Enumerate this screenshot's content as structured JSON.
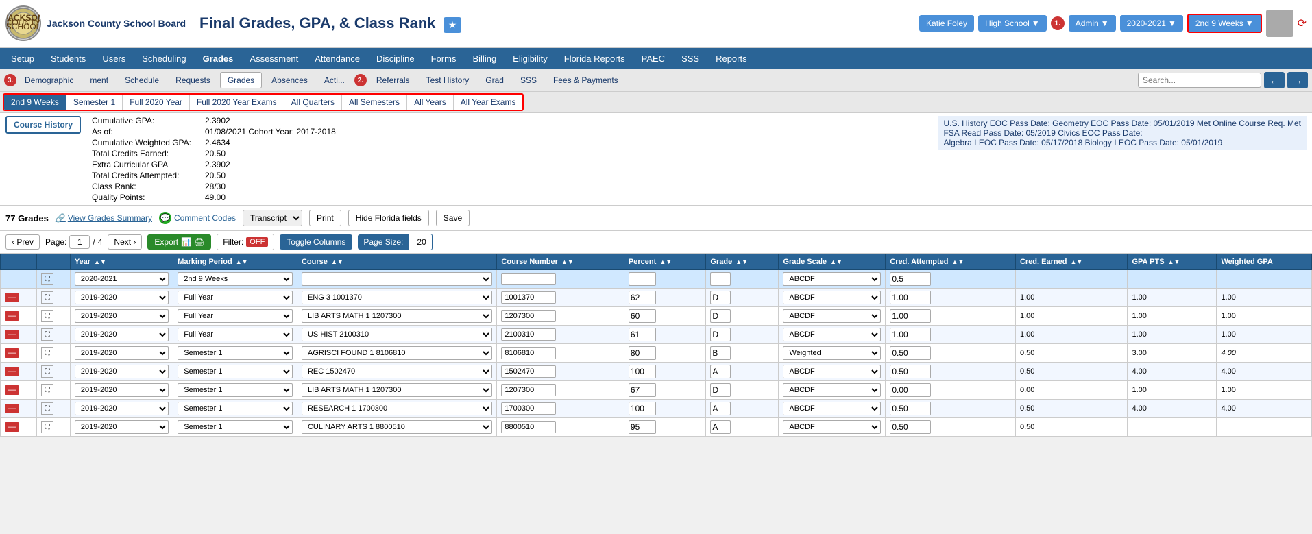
{
  "school": {
    "name": "Jackson County School Board",
    "logo_alt": "school logo"
  },
  "header": {
    "title": "Final Grades, GPA, & Class Rank",
    "user": "Katie Foley",
    "school_name": "High School",
    "role": "Admin",
    "year": "2020-2021",
    "period": "2nd 9 Weeks",
    "badge1": "1."
  },
  "nav": {
    "items": [
      "Setup",
      "Students",
      "Users",
      "Scheduling",
      "Grades",
      "Assessment",
      "Attendance",
      "Discipline",
      "Forms",
      "Billing",
      "Eligibility",
      "Florida Reports",
      "PAEC",
      "SSS",
      "Reports"
    ]
  },
  "subnav": {
    "items": [
      "Demographic",
      "3.",
      "ment",
      "Schedule",
      "Requests",
      "Grades",
      "Absences",
      "Acti...",
      "Referrals",
      "Test History",
      "Grad",
      "SSS",
      "Fees & Payments"
    ],
    "active": "Grades",
    "badge2": "2.",
    "badge3": "3.",
    "search_placeholder": "Search..."
  },
  "period_tabs": {
    "items": [
      "2nd 9 Weeks",
      "Semester 1",
      "Full 2020 Year",
      "Full 2020 Year Exams",
      "All Quarters",
      "All Semesters",
      "All Years",
      "All Year Exams"
    ],
    "active": "2nd 9 Weeks"
  },
  "course_history": {
    "label": "Course History"
  },
  "cumulative": {
    "gpa_label": "Cumulative GPA:",
    "gpa_val": "2.3902",
    "as_of_label": "As of:",
    "as_of_val": "01/08/2021 Cohort Year: 2017-2018",
    "weighted_gpa_label": "Cumulative Weighted GPA:",
    "weighted_gpa_val": "2.4634",
    "total_credits_earned_label": "Total Credits Earned:",
    "total_credits_earned_val": "20.50",
    "extra_gpa_label": "Extra Curricular GPA",
    "extra_gpa_val": "2.3902",
    "total_credits_attempted_label": "Total Credits Attempted:",
    "total_credits_attempted_val": "20.50",
    "class_rank_label": "Class Rank:",
    "class_rank_val": "28/30",
    "quality_points_label": "Quality Points:",
    "quality_points_val": "49.00"
  },
  "eoc": {
    "line1": "U.S. History EOC Pass Date:    Geometry EOC Pass Date: 05/01/2019 Met Online Course Req. Met",
    "line2": "FSA Read Pass Date: 05/2019     Civics EOC Pass Date:",
    "line3": "Algebra I EOC Pass Date: 05/17/2018  Biology I EOC Pass Date: 05/01/2019"
  },
  "grades_section": {
    "count": "77 Grades",
    "view_summary": "View Grades Summary",
    "comment_codes": "Comment Codes",
    "dropdown_default": "Transcript",
    "print_label": "Print",
    "hide_fl_label": "Hide Florida fields",
    "save_label": "Save"
  },
  "toolbar": {
    "prev_label": "‹ Prev",
    "page_label": "Page:",
    "page_current": "1",
    "page_total": "4",
    "next_label": "Next ›",
    "export_label": "Export",
    "filter_label": "Filter:",
    "filter_value": "OFF",
    "toggle_label": "Toggle Columns",
    "pagesize_label": "Page Size:",
    "pagesize_val": "20"
  },
  "table": {
    "headers": [
      "",
      "",
      "Year",
      "Marking Period",
      "Course",
      "Course Number",
      "Percent",
      "Grade",
      "Grade Scale",
      "Cred. Attempted",
      "Cred. Earned",
      "GPA PTS",
      "Weighted GPA"
    ],
    "rows": [
      {
        "type": "new",
        "year": "2020-2021",
        "mp": "2nd 9 Weeks",
        "course": "",
        "course_num": "",
        "percent": "",
        "grade": "",
        "grade_scale": "ABCDF",
        "cred_attempted": "0.5",
        "cred_earned": "",
        "gpa_pts": "",
        "weighted_gpa": ""
      },
      {
        "type": "data",
        "year": "2019-2020",
        "mp": "Full Year",
        "course": "ENG 3 1001370",
        "course_num": "1001370",
        "percent": "62",
        "grade": "D",
        "grade_scale": "ABCDF",
        "cred_attempted": "1.00",
        "cred_earned": "1.00",
        "gpa_pts": "1.00",
        "weighted_gpa": "1.00"
      },
      {
        "type": "data",
        "year": "2019-2020",
        "mp": "Full Year",
        "course": "LIB ARTS MATH 1 1207300",
        "course_num": "1207300",
        "percent": "60",
        "grade": "D",
        "grade_scale": "ABCDF",
        "cred_attempted": "1.00",
        "cred_earned": "1.00",
        "gpa_pts": "1.00",
        "weighted_gpa": "1.00"
      },
      {
        "type": "data",
        "year": "2019-2020",
        "mp": "Full Year",
        "course": "US HIST 2100310",
        "course_num": "2100310",
        "percent": "61",
        "grade": "D",
        "grade_scale": "ABCDF",
        "cred_attempted": "1.00",
        "cred_earned": "1.00",
        "gpa_pts": "1.00",
        "weighted_gpa": "1.00"
      },
      {
        "type": "data",
        "year": "2019-2020",
        "mp": "Semester 1",
        "course": "AGRISCI FOUND 1 8106810",
        "course_num": "8106810",
        "percent": "80",
        "grade": "B",
        "grade_scale": "Weighted",
        "cred_attempted": "0.50",
        "cred_earned": "0.50",
        "gpa_pts": "3.00",
        "weighted_gpa": "4.00"
      },
      {
        "type": "data",
        "year": "2019-2020",
        "mp": "Semester 1",
        "course": "REC 1502470",
        "course_num": "1502470",
        "percent": "100",
        "grade": "A",
        "grade_scale": "ABCDF",
        "cred_attempted": "0.50",
        "cred_earned": "0.50",
        "gpa_pts": "4.00",
        "weighted_gpa": "4.00"
      },
      {
        "type": "data",
        "year": "2019-2020",
        "mp": "Semester 1",
        "course": "LIB ARTS MATH 1 1207300",
        "course_num": "1207300",
        "percent": "67",
        "grade": "D",
        "grade_scale": "ABCDF",
        "cred_attempted": "0.00",
        "cred_earned": "0.00",
        "gpa_pts": "1.00",
        "weighted_gpa": "1.00"
      },
      {
        "type": "data",
        "year": "2019-2020",
        "mp": "Semester 1",
        "course": "RESEARCH 1 1700300",
        "course_num": "1700300",
        "percent": "100",
        "grade": "A",
        "grade_scale": "ABCDF",
        "cred_attempted": "0.50",
        "cred_earned": "0.50",
        "gpa_pts": "4.00",
        "weighted_gpa": "4.00"
      },
      {
        "type": "data",
        "year": "2019-2020",
        "mp": "Semester 1",
        "course": "CULINARY ARTS 1 8800510",
        "course_num": "8800510",
        "percent": "95",
        "grade": "A",
        "grade_scale": "ABCDF",
        "cred_attempted": "0.50",
        "cred_earned": "0.50",
        "gpa_pts": "",
        "weighted_gpa": ""
      }
    ]
  }
}
